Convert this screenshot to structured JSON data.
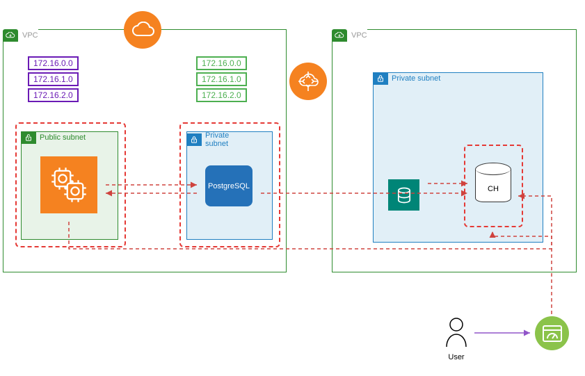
{
  "vpc_left": {
    "label": "VPC"
  },
  "vpc_right": {
    "label": "VPC"
  },
  "ip_purple": [
    "172.16.0.0",
    "172.16.1.0",
    "172.16.2.0"
  ],
  "ip_green": [
    "172.16.0.0",
    "172.16.1.0",
    "172.16.2.0"
  ],
  "subnet_public": {
    "label": "Public subnet"
  },
  "subnet_private_left": {
    "label": "Private subnet"
  },
  "subnet_private_right": {
    "label": "Private subnet"
  },
  "postgres": {
    "label": "PostgreSQL"
  },
  "cylinder": {
    "label": "CH"
  },
  "user": {
    "label": "User"
  }
}
